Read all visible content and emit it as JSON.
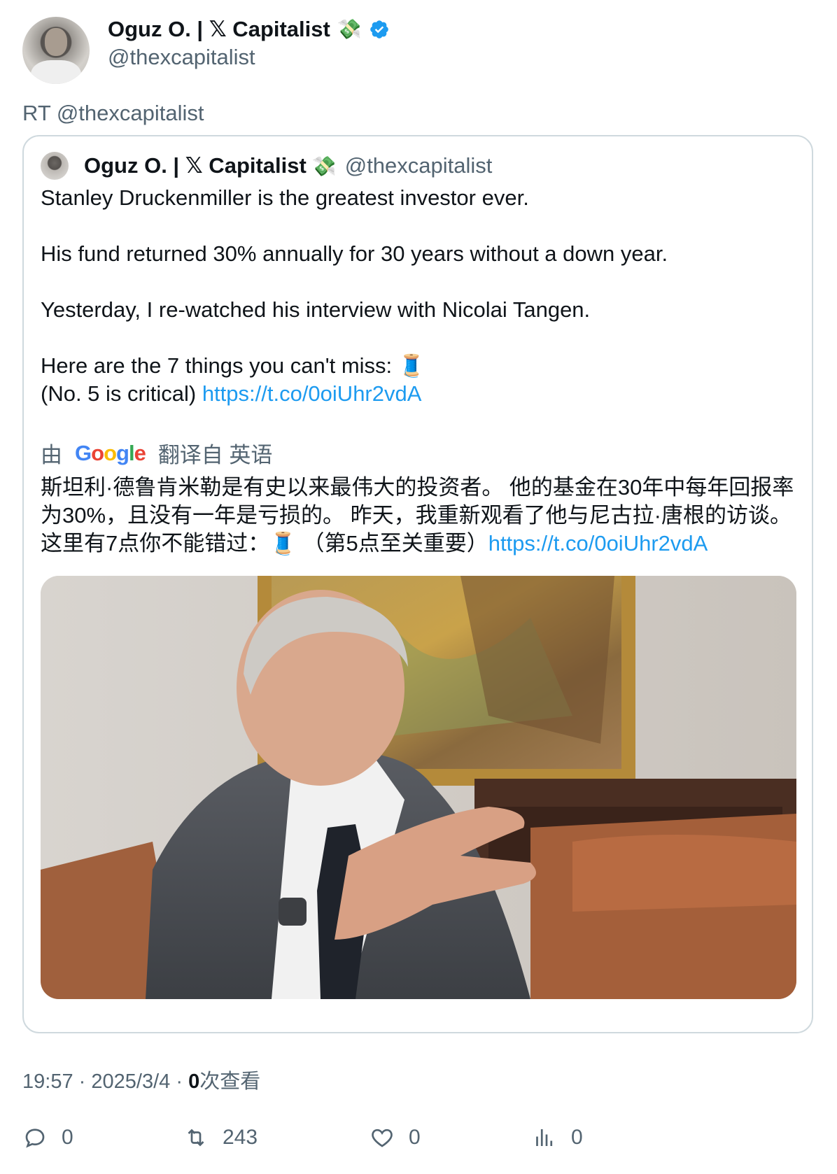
{
  "author": {
    "display_name": "Oguz O. | 𝕏 Capitalist",
    "emoji": "💸",
    "handle": "@thexcapitalist",
    "verified": true
  },
  "retweet_label": "RT @thexcapitalist",
  "quoted_tweet": {
    "display_name": "Oguz O. | 𝕏 Capitalist",
    "emoji": "💸",
    "handle": "@thexcapitalist",
    "paragraphs": [
      "Stanley Druckenmiller is the greatest investor ever.",
      "His fund returned 30% annually for 30 years without a down year.",
      "Yesterday, I re-watched his interview with Nicolai Tangen.",
      "Here are the 7 things you can't miss: 🧵"
    ],
    "last_line_text": "(No. 5 is critical) ",
    "link": "https://t.co/0oiUhr2vdA",
    "translation": {
      "prefix": "由",
      "provider": "Google",
      "suffix": "翻译自 英语",
      "text": "斯坦利·德鲁肯米勒是有史以来最伟大的投资者。 他的基金在30年中每年回报率为30%，且没有一年是亏损的。 昨天，我重新观看了他与尼古拉·唐根的访谈。 这里有7点你不能错过：🧵 （第5点至关重要）",
      "link": "https://t.co/0oiUhr2vdA"
    }
  },
  "meta": {
    "time": "19:57",
    "date": "2025/3/4",
    "views_count": "0",
    "views_label": "次查看",
    "separator": "·"
  },
  "actions": {
    "replies": "0",
    "retweets": "243",
    "likes": "0",
    "views": "0"
  },
  "colors": {
    "link": "#1d9bf0",
    "secondary_text": "#536471",
    "verified": "#1d9bf0",
    "border": "#cfd9de"
  }
}
